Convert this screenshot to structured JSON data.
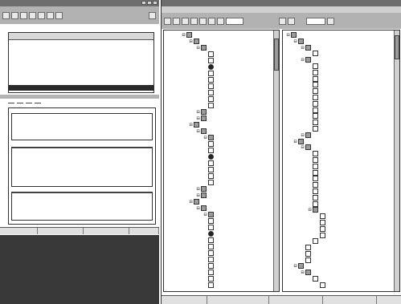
{
  "left_window": {
    "title": "",
    "section_label": "",
    "list_header": "",
    "list_items": [
      {
        "text": "",
        "selected": false
      },
      {
        "text": "",
        "selected": false
      },
      {
        "text": "",
        "selected": false
      },
      {
        "text": "",
        "selected": false
      },
      {
        "text": "",
        "selected": false
      },
      {
        "text": "",
        "selected": false
      },
      {
        "text": "",
        "selected": false
      },
      {
        "text": "",
        "selected": false
      },
      {
        "text": "",
        "selected": true
      }
    ],
    "tabs": [
      "",
      "",
      "",
      ""
    ],
    "description_lines": [
      "",
      "",
      "",
      ""
    ],
    "detail_header": "",
    "detail_lines": [
      "",
      "",
      ""
    ],
    "lower_header": "",
    "lower_lines": [
      ""
    ],
    "status": [
      "",
      "",
      "",
      ""
    ]
  },
  "right_window": {
    "title": "",
    "menu": [
      "",
      "",
      "",
      ""
    ],
    "pane1": {
      "rows": [
        {
          "indent": 2,
          "icon": "folder",
          "text": ""
        },
        {
          "indent": 3,
          "icon": "folder",
          "text": ""
        },
        {
          "indent": 4,
          "icon": "folder",
          "text": ""
        },
        {
          "indent": 5,
          "icon": "item",
          "text": ""
        },
        {
          "indent": 5,
          "icon": "item",
          "text": ""
        },
        {
          "indent": 5,
          "icon": "bug",
          "text": ""
        },
        {
          "indent": 5,
          "icon": "item",
          "text": ""
        },
        {
          "indent": 5,
          "icon": "item",
          "text": ""
        },
        {
          "indent": 5,
          "icon": "item",
          "text": ""
        },
        {
          "indent": 5,
          "icon": "item",
          "text": ""
        },
        {
          "indent": 5,
          "icon": "item",
          "text": ""
        },
        {
          "indent": 5,
          "icon": "item",
          "text": ""
        },
        {
          "indent": 4,
          "icon": "folder",
          "text": ""
        },
        {
          "indent": 4,
          "icon": "folder",
          "text": ""
        },
        {
          "indent": 3,
          "icon": "folder",
          "text": ""
        },
        {
          "indent": 4,
          "icon": "folder",
          "text": ""
        },
        {
          "indent": 5,
          "icon": "folder",
          "text": ""
        },
        {
          "indent": 5,
          "icon": "item",
          "text": ""
        },
        {
          "indent": 5,
          "icon": "item",
          "text": ""
        },
        {
          "indent": 5,
          "icon": "bug",
          "text": ""
        },
        {
          "indent": 5,
          "icon": "item",
          "text": ""
        },
        {
          "indent": 5,
          "icon": "item",
          "text": ""
        },
        {
          "indent": 5,
          "icon": "item",
          "text": ""
        },
        {
          "indent": 5,
          "icon": "item",
          "text": ""
        },
        {
          "indent": 4,
          "icon": "folder",
          "text": ""
        },
        {
          "indent": 4,
          "icon": "folder",
          "text": ""
        },
        {
          "indent": 3,
          "icon": "folder",
          "text": ""
        },
        {
          "indent": 4,
          "icon": "folder",
          "text": ""
        },
        {
          "indent": 5,
          "icon": "folder",
          "text": ""
        },
        {
          "indent": 5,
          "icon": "item",
          "text": ""
        },
        {
          "indent": 5,
          "icon": "item",
          "text": ""
        },
        {
          "indent": 5,
          "icon": "bug",
          "text": ""
        },
        {
          "indent": 5,
          "icon": "item",
          "text": ""
        },
        {
          "indent": 5,
          "icon": "item",
          "text": ""
        },
        {
          "indent": 5,
          "icon": "item",
          "text": ""
        },
        {
          "indent": 5,
          "icon": "item",
          "text": ""
        },
        {
          "indent": 5,
          "icon": "item",
          "text": ""
        },
        {
          "indent": 5,
          "icon": "item",
          "text": ""
        },
        {
          "indent": 5,
          "icon": "item",
          "text": ""
        },
        {
          "indent": 5,
          "icon": "item",
          "text": ""
        }
      ]
    },
    "pane2": {
      "rows": [
        {
          "indent": 0,
          "icon": "folder",
          "text": ""
        },
        {
          "indent": 1,
          "icon": "folder",
          "text": ""
        },
        {
          "indent": 2,
          "icon": "folder",
          "text": ""
        },
        {
          "indent": 3,
          "icon": "item",
          "text": ""
        },
        {
          "indent": 2,
          "icon": "folder",
          "text": ""
        },
        {
          "indent": 3,
          "icon": "item",
          "text": ""
        },
        {
          "indent": 3,
          "icon": "item",
          "text": ""
        },
        {
          "indent": 3,
          "icon": "item",
          "text": ""
        },
        {
          "indent": 3,
          "icon": "item",
          "text": ""
        },
        {
          "indent": 3,
          "icon": "item",
          "text": ""
        },
        {
          "indent": 3,
          "icon": "item",
          "text": ""
        },
        {
          "indent": 3,
          "icon": "item",
          "text": ""
        },
        {
          "indent": 3,
          "icon": "item",
          "text": ""
        },
        {
          "indent": 3,
          "icon": "item",
          "text": ""
        },
        {
          "indent": 3,
          "icon": "item",
          "text": ""
        },
        {
          "indent": 3,
          "icon": "item",
          "text": ""
        },
        {
          "indent": 2,
          "icon": "folder",
          "text": ""
        },
        {
          "indent": 1,
          "icon": "folder",
          "text": ""
        },
        {
          "indent": 2,
          "icon": "folder",
          "text": ""
        },
        {
          "indent": 3,
          "icon": "item",
          "text": ""
        },
        {
          "indent": 3,
          "icon": "item",
          "text": ""
        },
        {
          "indent": 3,
          "icon": "item",
          "text": ""
        },
        {
          "indent": 3,
          "icon": "item",
          "text": ""
        },
        {
          "indent": 3,
          "icon": "item",
          "text": ""
        },
        {
          "indent": 3,
          "icon": "item",
          "text": ""
        },
        {
          "indent": 3,
          "icon": "item",
          "text": ""
        },
        {
          "indent": 3,
          "icon": "item",
          "text": ""
        },
        {
          "indent": 3,
          "icon": "item",
          "text": ""
        },
        {
          "indent": 3,
          "icon": "folder",
          "text": ""
        },
        {
          "indent": 4,
          "icon": "item",
          "text": ""
        },
        {
          "indent": 4,
          "icon": "item",
          "text": ""
        },
        {
          "indent": 4,
          "icon": "item",
          "text": ""
        },
        {
          "indent": 4,
          "icon": "item",
          "text": ""
        },
        {
          "indent": 3,
          "icon": "item",
          "text": ""
        },
        {
          "indent": 2,
          "icon": "item",
          "text": ""
        },
        {
          "indent": 2,
          "icon": "item",
          "text": ""
        },
        {
          "indent": 2,
          "icon": "item",
          "text": ""
        },
        {
          "indent": 1,
          "icon": "folder",
          "text": ""
        },
        {
          "indent": 2,
          "icon": "folder",
          "text": ""
        },
        {
          "indent": 3,
          "icon": "item",
          "text": ""
        },
        {
          "indent": 4,
          "icon": "item",
          "text": ""
        }
      ]
    },
    "status": [
      "",
      "",
      "",
      "",
      ""
    ]
  },
  "colors": {
    "titlebar": "#6e6e6e",
    "selection": "#2a2a2a",
    "background": "#ffffff"
  }
}
